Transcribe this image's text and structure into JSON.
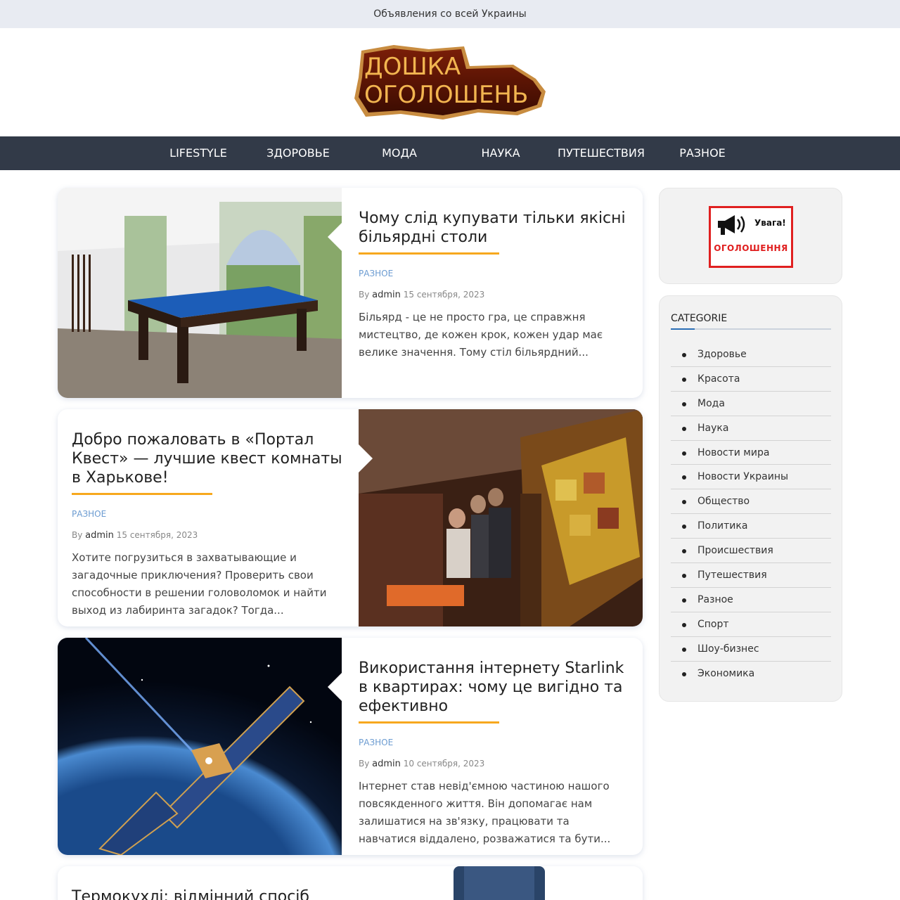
{
  "topbar": {
    "text": "Объявления со всей Украины"
  },
  "logo": {
    "line1": "ДОШКА",
    "line2": "ОГОЛОШЕНЬ"
  },
  "nav": {
    "items": [
      {
        "label": "LIFESTYLE"
      },
      {
        "label": "ЗДОРОВЬЕ"
      },
      {
        "label": "МОДА"
      },
      {
        "label": "НАУКА"
      },
      {
        "label": "ПУТЕШЕСТВИЯ"
      },
      {
        "label": "РАЗНОЕ"
      }
    ]
  },
  "posts": [
    {
      "title": "Чому слід купувати тільки якісні більярдні столи",
      "category": "РАЗНОЕ",
      "by": "By",
      "author": "admin",
      "date": "15 сентября, 2023",
      "excerpt": "Більярд - це не просто гра, це справжня мистецтво, де кожен крок, кожен удар має велике значення. Тому стіл більярдний..."
    },
    {
      "title": "Добро пожаловать в «Портал Квест» — лучшие квест комнаты в Харькове!",
      "category": "РАЗНОЕ",
      "by": "By",
      "author": "admin",
      "date": "15 сентября, 2023",
      "excerpt": "Хотите погрузиться в захватывающие и загадочные приключения? Проверить свои способности в решении головоломок и найти выход из лабиринта загадок? Тогда..."
    },
    {
      "title": "Використання інтернету Starlink в квартирах: чому це вигідно та ефективно",
      "category": "РАЗНОЕ",
      "by": "By",
      "author": "admin",
      "date": "10 сентября, 2023",
      "excerpt": "Інтернет став невід'ємною частиною нашого повсякденного життя. Він допомагає нам залишатися на зв'язку, працювати та навчатися віддалено, розважатися та бути..."
    },
    {
      "title": "Термокухлі: відмінний спосіб"
    }
  ],
  "sidebar": {
    "banner": {
      "line1": "Увага!",
      "line2": "ОГОЛОШЕННЯ"
    },
    "categories_title": "CATEGORIE",
    "categories": [
      "Здоровье",
      "Красота",
      "Мода",
      "Наука",
      "Новости мира",
      "Новости Украины",
      "Общество",
      "Политика",
      "Происшествия",
      "Путешествия",
      "Разное",
      "Спорт",
      "Шоу-бизнес",
      "Экономика"
    ]
  },
  "colors": {
    "nav_bg": "#323a48",
    "accent": "#f7a81e",
    "category_link": "#6b9bd1"
  }
}
